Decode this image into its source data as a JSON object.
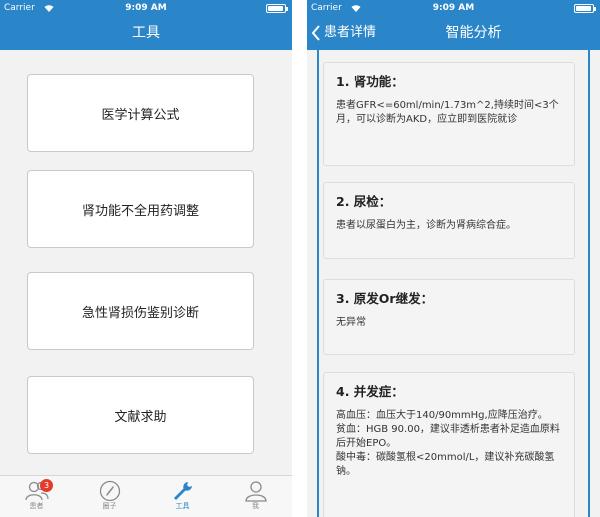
{
  "left": {
    "status": {
      "carrier": "Carrier",
      "time": "9:09 AM"
    },
    "nav_title": "工具",
    "menu": [
      "医学计算公式",
      "肾功能不全用药调整",
      "急性肾损伤鉴别诊断",
      "文献求助"
    ],
    "tabs": [
      {
        "label": "患者",
        "badge": "3"
      },
      {
        "label": "圈子"
      },
      {
        "label": "工具"
      },
      {
        "label": "我"
      }
    ]
  },
  "right": {
    "status": {
      "carrier": "Carrier",
      "time": "9:09 AM"
    },
    "back_label": "患者详情",
    "nav_title": "智能分析",
    "cards": [
      {
        "title": "1. 肾功能：",
        "lines": [
          "患者GFR<=60ml/min/1.73m^2,持续时间<3个月，可以诊断为AKD，应立即到医院就诊"
        ]
      },
      {
        "title": "2. 尿检：",
        "lines": [
          "患者以尿蛋白为主，诊断为肾病综合症。"
        ]
      },
      {
        "title": "3. 原发Or继发：",
        "lines": [
          "无异常"
        ]
      },
      {
        "title": "4. 并发症：",
        "lines": [
          "高血压：血压大于140/90mmHg,应降压治疗。",
          "贫血：HGB 90.00，建议非透析患者补足造血原料后开始EPO。",
          "酸中毒：碳酸氢根<20mmol/L，建议补充碳酸氢钠。"
        ]
      }
    ]
  },
  "colors": {
    "accent": "#2a86c8",
    "badge": "#e33a2c"
  }
}
